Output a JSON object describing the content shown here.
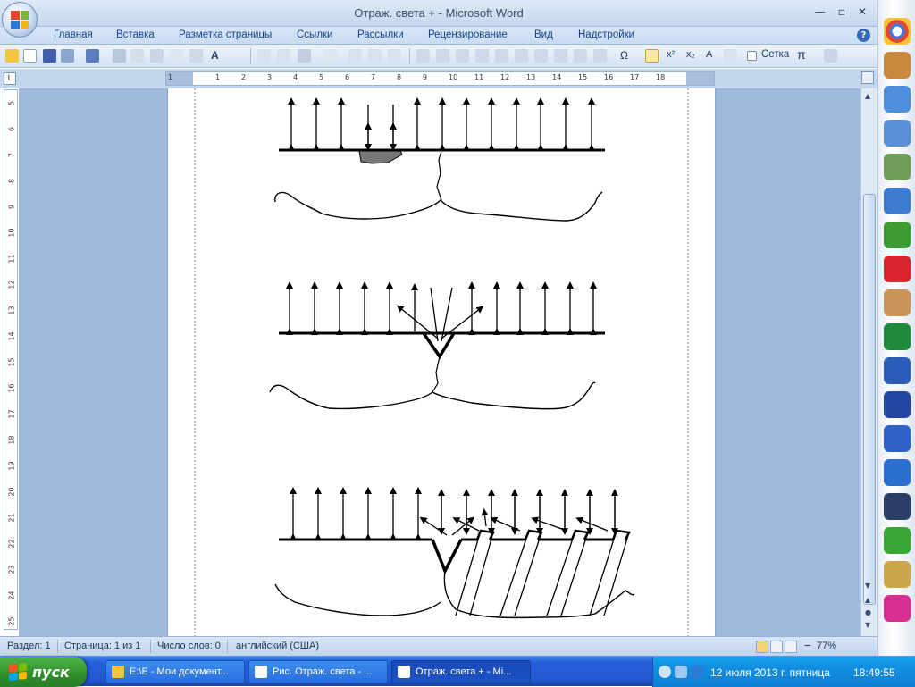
{
  "window": {
    "title": "Отраж. света + - Microsoft Word",
    "minimize": "—",
    "restore": "▫",
    "close": "✕"
  },
  "ribbon": {
    "tabs": [
      {
        "label": "Главная"
      },
      {
        "label": "Вставка"
      },
      {
        "label": "Разметка страницы"
      },
      {
        "label": "Ссылки"
      },
      {
        "label": "Рассылки"
      },
      {
        "label": "Рецензирование"
      },
      {
        "label": "Вид"
      },
      {
        "label": "Надстройки"
      }
    ],
    "help": "?"
  },
  "toolbar": {
    "superscript": "x²",
    "subscript": "x₂",
    "font_grow": "A",
    "grid_label": "Сетка",
    "pi": "π",
    "omega": "Ω"
  },
  "ruler": {
    "corner": "L",
    "h_numbers": [
      "1",
      "1",
      "2",
      "3",
      "4",
      "5",
      "6",
      "7",
      "8",
      "9",
      "10",
      "11",
      "12",
      "13",
      "14",
      "15",
      "16",
      "17",
      "18"
    ],
    "v_numbers": [
      "5",
      "6",
      "7",
      "8",
      "9",
      "10",
      "11",
      "12",
      "13",
      "14",
      "15",
      "16",
      "17",
      "18",
      "19",
      "20",
      "21",
      "22",
      "23",
      "24",
      "25"
    ]
  },
  "status": {
    "section": "Раздел: 1",
    "page": "Страница: 1 из 1",
    "words": "Число слов: 0",
    "language": "английский (США)",
    "zoom": "77%",
    "zoom_minus": "−",
    "zoom_plus": "+"
  },
  "taskbar": {
    "start": "пуск",
    "items": [
      {
        "label": "E:\\E - Мои документ..."
      },
      {
        "label": "Рис. Отраж. света - ..."
      },
      {
        "label": "Отраж. света + - Mi..."
      }
    ],
    "date": "12 июля 2013 г. пятница",
    "time": "18:49:55"
  },
  "colors": {
    "accent": "#15428b",
    "taskbar": "#245edb",
    "start": "#2f8f2b",
    "tray": "#1290e2"
  }
}
